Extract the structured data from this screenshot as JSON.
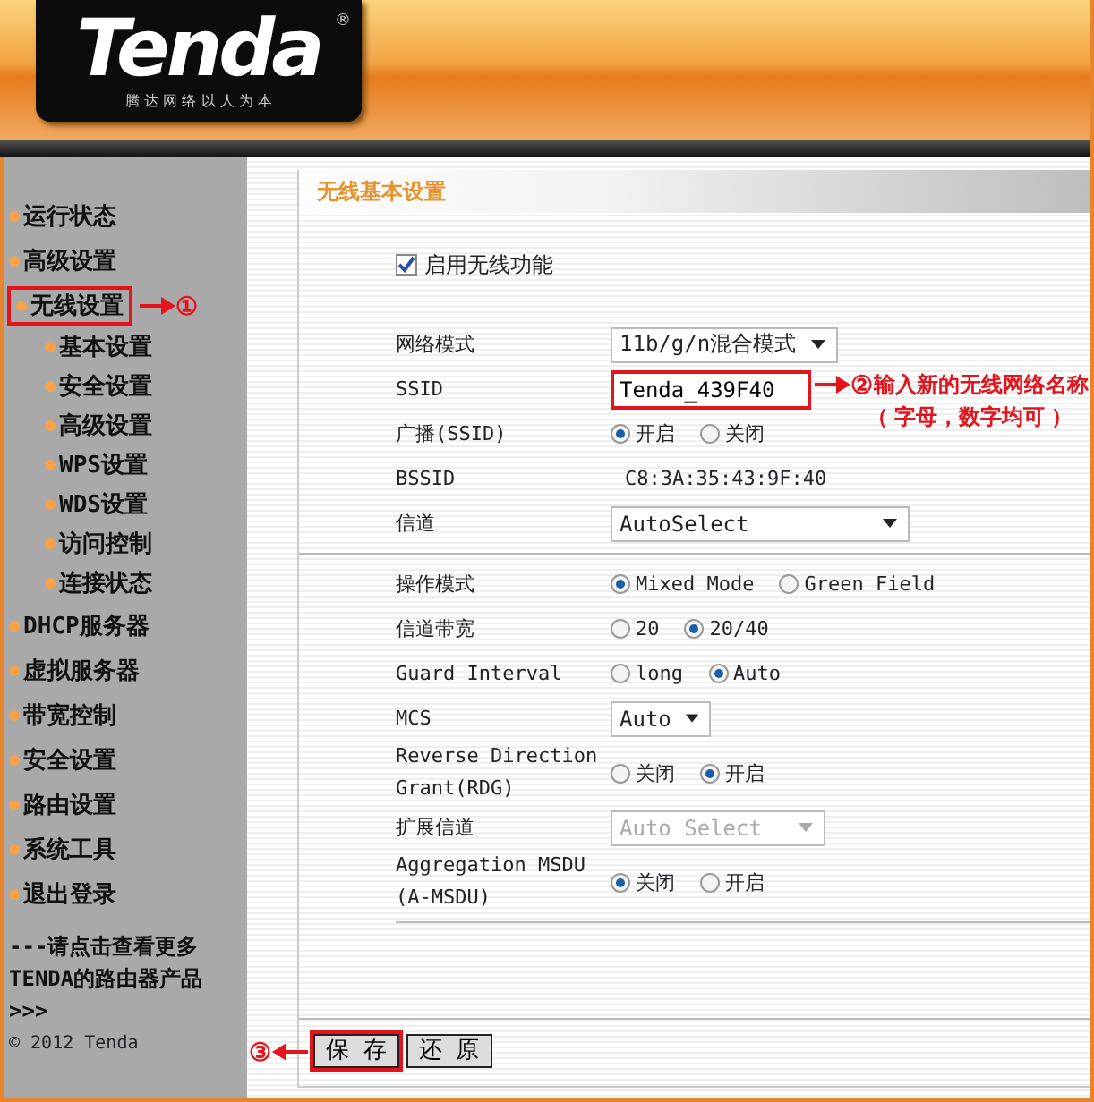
{
  "logo": {
    "brand": "Tenda",
    "registered": "®",
    "tagline": "腾 达 网 络 以 人 为 本"
  },
  "sidebar": {
    "items": [
      {
        "label": "运行状态",
        "selected": false
      },
      {
        "label": "高级设置",
        "selected": false
      },
      {
        "label": "无线设置",
        "selected": true,
        "callout": "①",
        "children": [
          {
            "label": "基本设置",
            "selected": false
          },
          {
            "label": "安全设置",
            "selected": false
          },
          {
            "label": "高级设置",
            "selected": false
          },
          {
            "label": "WPS设置",
            "selected": false
          },
          {
            "label": "WDS设置",
            "selected": false
          },
          {
            "label": "访问控制",
            "selected": false
          },
          {
            "label": "连接状态",
            "selected": false
          }
        ]
      },
      {
        "label": "DHCP服务器",
        "selected": false
      },
      {
        "label": "虚拟服务器",
        "selected": false
      },
      {
        "label": "带宽控制",
        "selected": false
      },
      {
        "label": "安全设置",
        "selected": false
      },
      {
        "label": "路由设置",
        "selected": false
      },
      {
        "label": "系统工具",
        "selected": false
      },
      {
        "label": "退出登录",
        "selected": false
      }
    ],
    "promo_lines": [
      "---请点击查看更多",
      "TENDA的路由器产品",
      ">>>"
    ],
    "copyright": "© 2012 Tenda"
  },
  "panel": {
    "title": "无线基本设置",
    "enable": {
      "label": "启用无线功能",
      "checked": true
    },
    "basic_fields": [
      {
        "kind": "select",
        "label": "网络模式",
        "value": "11b/g/n混合模式"
      },
      {
        "kind": "input",
        "label": "SSID",
        "value": "Tenda_439F40",
        "callout": "②",
        "callout_lines": [
          "输入新的无线网络名称",
          "（ 字母，数字均可 ）"
        ]
      },
      {
        "kind": "radio",
        "label": "广播(SSID)",
        "options": [
          {
            "label": "开启",
            "selected": true
          },
          {
            "label": "关闭",
            "selected": false
          }
        ]
      },
      {
        "kind": "text",
        "label": "BSSID",
        "value": "C8:3A:35:43:9F:40"
      },
      {
        "kind": "select",
        "label": "信道",
        "value": "AutoSelect"
      }
    ],
    "advanced_fields": [
      {
        "kind": "radio",
        "label": "操作模式",
        "options": [
          {
            "label": "Mixed Mode",
            "selected": true
          },
          {
            "label": "Green Field",
            "selected": false
          }
        ]
      },
      {
        "kind": "radio",
        "label": "信道带宽",
        "options": [
          {
            "label": "20",
            "selected": false
          },
          {
            "label": "20/40",
            "selected": true
          }
        ]
      },
      {
        "kind": "radio",
        "label": "Guard Interval",
        "options": [
          {
            "label": "long",
            "selected": false
          },
          {
            "label": "Auto",
            "selected": true
          }
        ]
      },
      {
        "kind": "select",
        "label": "MCS",
        "value": "Auto"
      },
      {
        "kind": "radio",
        "label": "Reverse Direction Grant(RDG)",
        "options": [
          {
            "label": "关闭",
            "selected": false
          },
          {
            "label": "开启",
            "selected": true
          }
        ]
      },
      {
        "kind": "select",
        "label": "扩展信道",
        "value": "Auto Select",
        "disabled": true
      },
      {
        "kind": "radio",
        "label": "Aggregation MSDU (A-MSDU)",
        "options": [
          {
            "label": "关闭",
            "selected": true
          },
          {
            "label": "开启",
            "selected": false
          }
        ]
      }
    ],
    "buttons": [
      {
        "label": "保 存",
        "callout": "③"
      },
      {
        "label": "还 原"
      }
    ]
  }
}
